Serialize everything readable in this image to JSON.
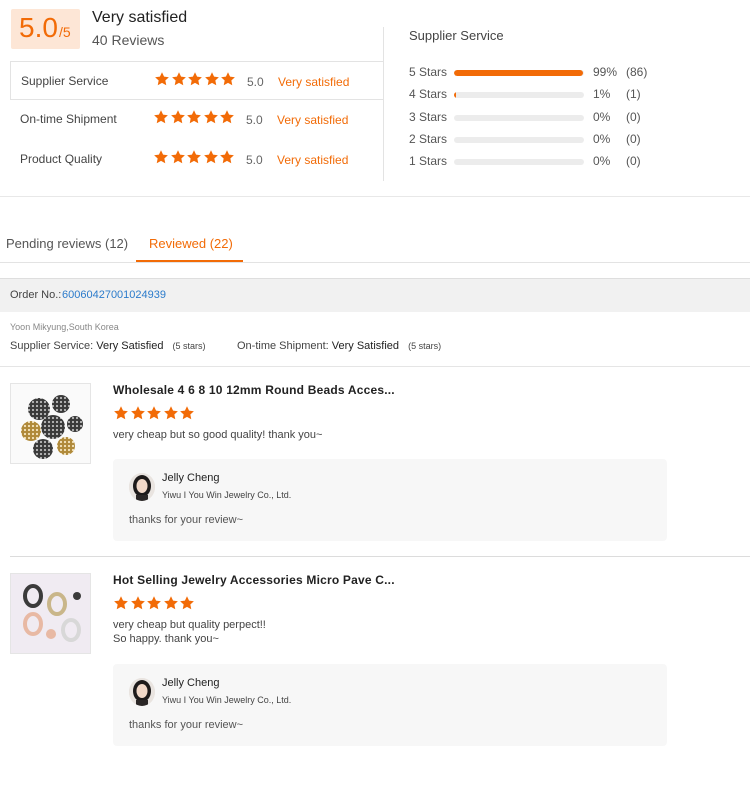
{
  "summary": {
    "score": "5.0",
    "score_suffix": "/5",
    "overall_label": "Very satisfied",
    "review_count": "40 Reviews",
    "rows": [
      {
        "label": "Supplier Service",
        "stars": 5,
        "value": "5.0",
        "text": "Very satisfied"
      },
      {
        "label": "On-time Shipment",
        "stars": 5,
        "value": "5.0",
        "text": "Very satisfied"
      },
      {
        "label": "Product Quality",
        "stars": 5,
        "value": "5.0",
        "text": "Very satisfied"
      }
    ],
    "distribution_title": "Supplier Service",
    "distribution": [
      {
        "label": "5 Stars",
        "fraction": 0.99,
        "percent": "99%",
        "count": "(86)"
      },
      {
        "label": "4 Stars",
        "fraction": 0.01,
        "percent": "1%",
        "count": "(1)"
      },
      {
        "label": "3 Stars",
        "fraction": 0,
        "percent": "0%",
        "count": "(0)"
      },
      {
        "label": "2 Stars",
        "fraction": 0,
        "percent": "0%",
        "count": "(0)"
      },
      {
        "label": "1 Stars",
        "fraction": 0,
        "percent": "0%",
        "count": "(0)"
      }
    ]
  },
  "tabs": {
    "pending": "Pending reviews (12)",
    "reviewed": "Reviewed (22)",
    "active": "reviewed"
  },
  "order": {
    "label": "Order No.:",
    "number": "60060427001024939",
    "buyer": "Yoon Mikyung,South Korea",
    "supplier_service_label": "Supplier Service:",
    "supplier_service_value": "Very Satisfied",
    "supplier_service_stars": "(5 stars)",
    "shipment_label": "On-time Shipment:",
    "shipment_value": "Very Satisfied",
    "shipment_stars": "(5 stars)"
  },
  "reviews": [
    {
      "title": "Wholesale 4 6 8 10 12mm Round Beads Acces...",
      "stars": 5,
      "comment": [
        "very cheap but so good quality! thank you~"
      ],
      "reply": {
        "name": "Jelly Cheng",
        "company": "Yiwu I You Win Jewelry Co., Ltd.",
        "text": "thanks for your review~"
      }
    },
    {
      "title": "Hot Selling Jewelry Accessories Micro Pave C...",
      "stars": 5,
      "comment": [
        "very cheap but quality perpect!!",
        "So happy. thank you~"
      ],
      "reply": {
        "name": "Jelly Cheng",
        "company": "Yiwu I You Win Jewelry Co., Ltd.",
        "text": "thanks for your review~"
      }
    }
  ],
  "colors": {
    "accent": "#f26b07",
    "score_bg": "#fde6d6",
    "link": "#2b7bcb",
    "track": "#ececec"
  },
  "icons": {
    "star": "star-icon",
    "avatar": "avatar-photo"
  }
}
